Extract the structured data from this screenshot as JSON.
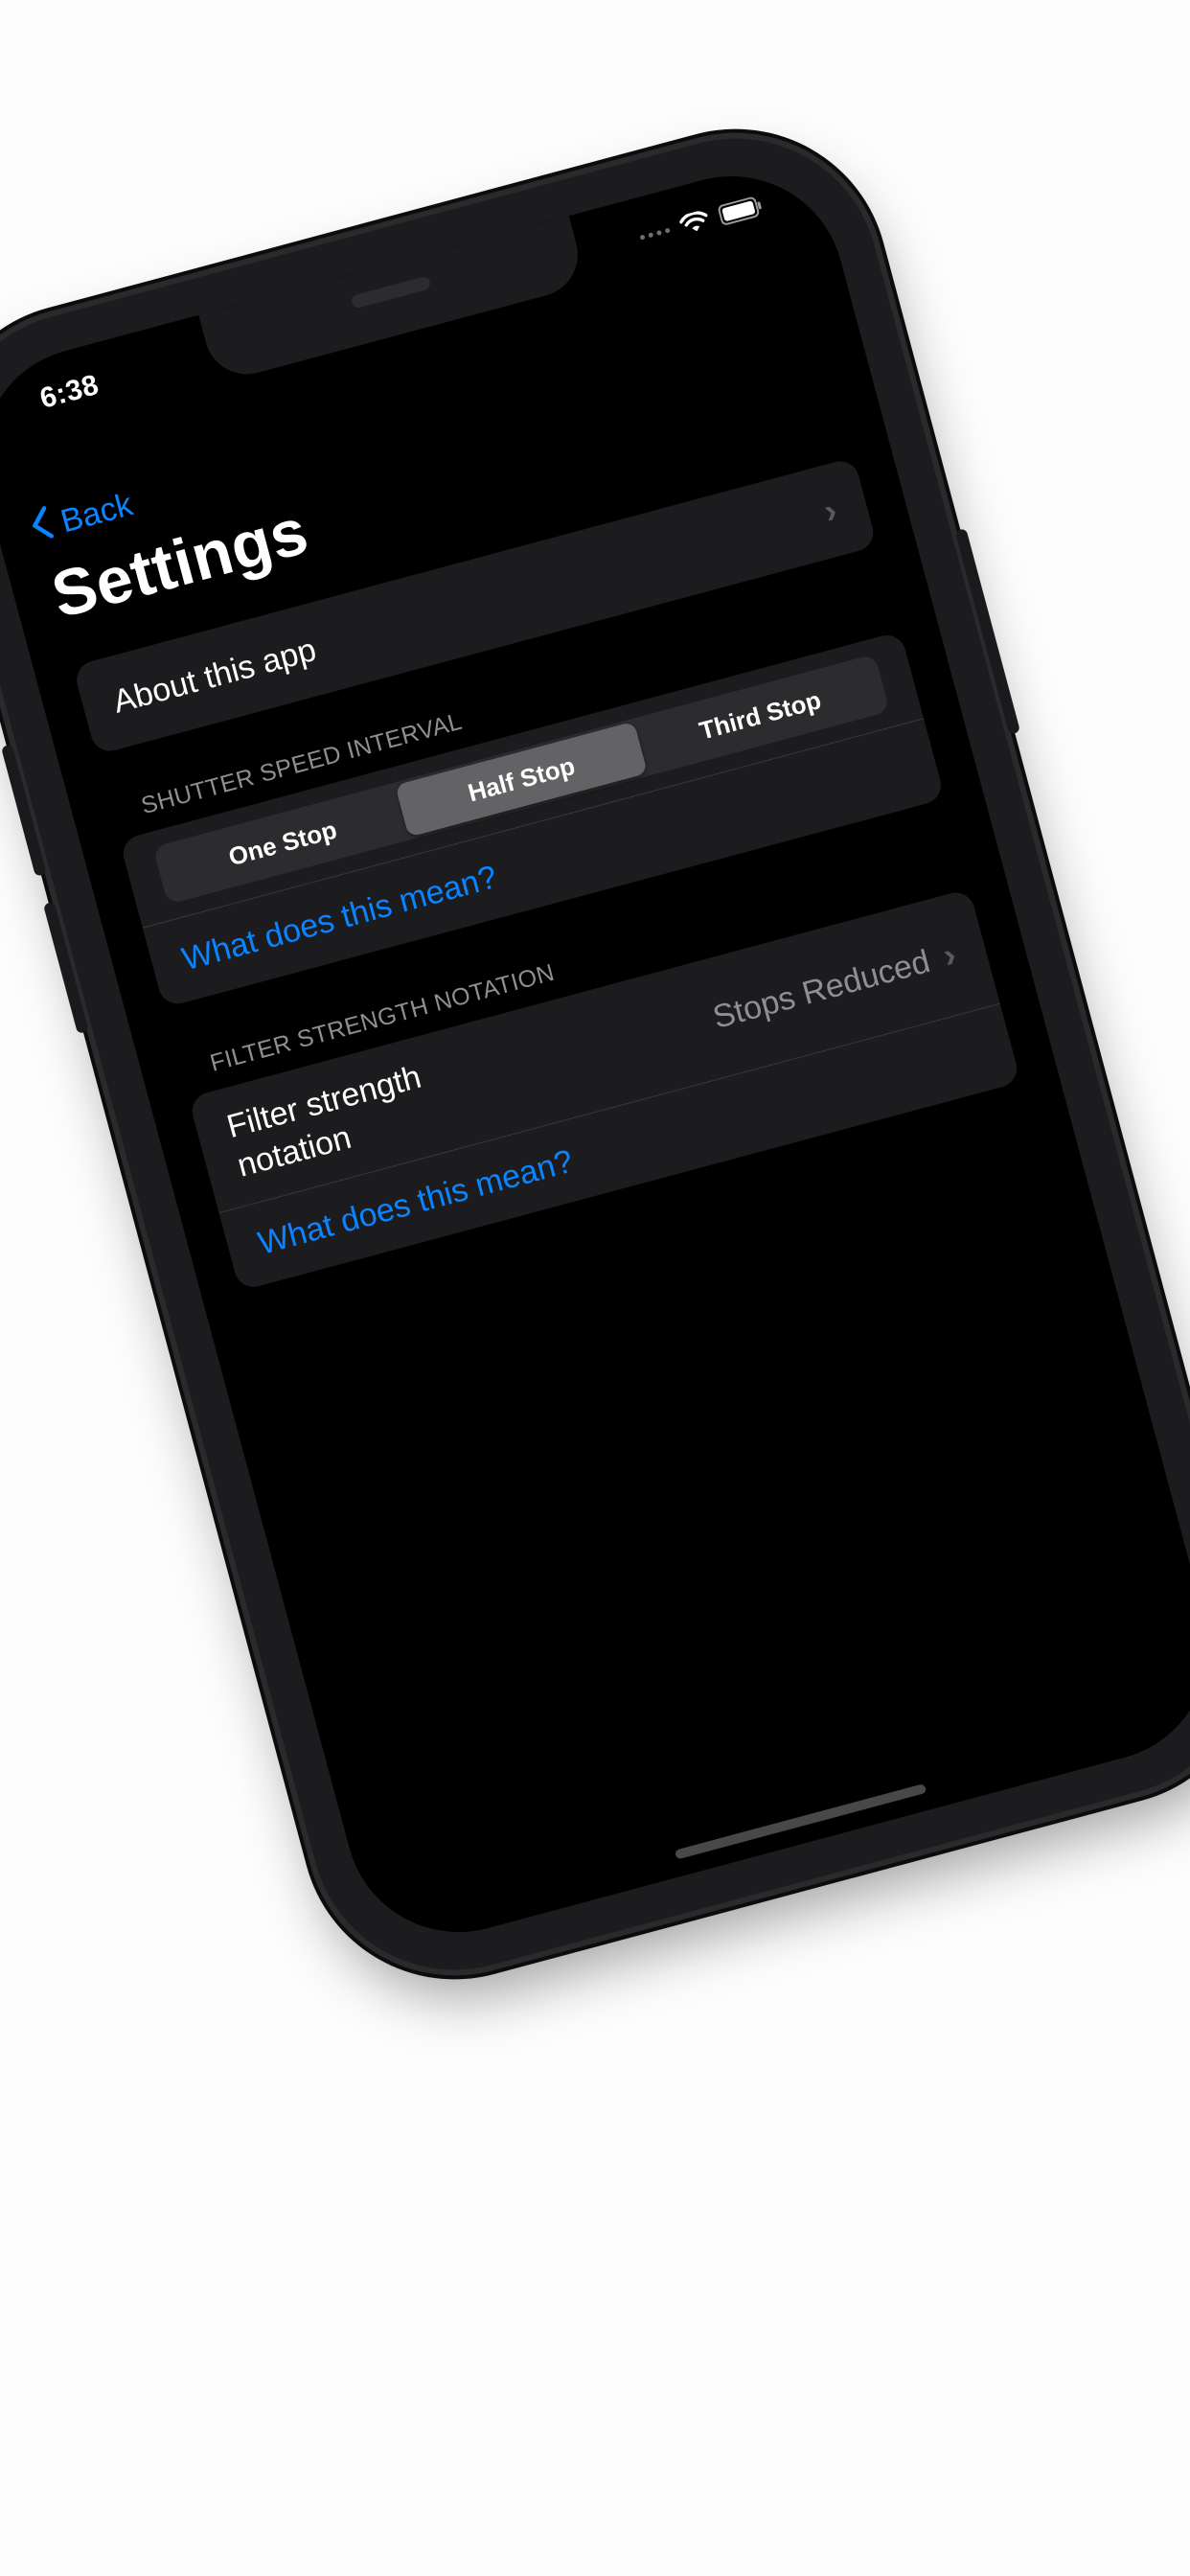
{
  "status_bar": {
    "time": "6:38",
    "wifi_icon": "wifi-icon",
    "battery_icon": "battery-icon"
  },
  "nav": {
    "back_label": "Back",
    "back_icon": "chevron-left-icon"
  },
  "page": {
    "title": "Settings"
  },
  "about_group": {
    "label": "About this app",
    "chevron_icon": "chevron-right-icon"
  },
  "shutter_section": {
    "header": "SHUTTER SPEED INTERVAL",
    "segments": [
      "One Stop",
      "Half Stop",
      "Third Stop"
    ],
    "selected": "Half Stop",
    "help_link": "What does this mean?"
  },
  "filter_section": {
    "header": "FILTER STRENGTH NOTATION",
    "row_label": "Filter strength notation",
    "row_value": "Stops Reduced",
    "chevron_icon": "chevron-right-icon",
    "help_link": "What does this mean?"
  },
  "colors": {
    "accent": "#0a84ff",
    "background": "#000000",
    "cell": "#1c1c1e",
    "secondary_text": "#8e8e93"
  }
}
